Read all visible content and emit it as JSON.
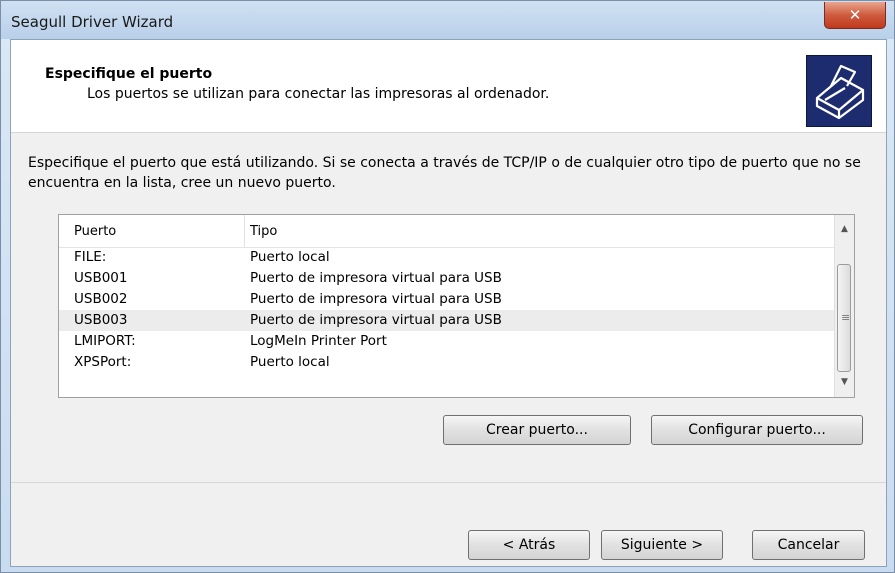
{
  "window": {
    "title": "Seagull Driver Wizard",
    "close_glyph": "✕"
  },
  "header": {
    "title": "Especifique el puerto",
    "subtitle": "Los puertos se utilizan para conectar las impresoras al ordenador.",
    "icon": "printer-icon"
  },
  "description": "Especifique el puerto que está utilizando. Si se conecta a través de TCP/IP o de cualquier otro tipo de puerto que no se encuentra en la lista, cree un nuevo puerto.",
  "port_list": {
    "columns": [
      "Puerto",
      "Tipo"
    ],
    "rows": [
      {
        "port": "FILE:",
        "type": "Puerto local",
        "selected": false
      },
      {
        "port": "USB001",
        "type": "Puerto de impresora virtual para USB",
        "selected": false
      },
      {
        "port": "USB002",
        "type": "Puerto de impresora virtual para USB",
        "selected": false
      },
      {
        "port": "USB003",
        "type": "Puerto de impresora virtual para USB",
        "selected": true
      },
      {
        "port": "LMIPORT:",
        "type": "LogMeIn Printer Port",
        "selected": false
      },
      {
        "port": "XPSPort:",
        "type": "Puerto local",
        "selected": false
      }
    ]
  },
  "buttons": {
    "create_port": "Crear puerto...",
    "configure_port": "Configurar puerto...",
    "back": "< Atrás",
    "next": "Siguiente >",
    "cancel": "Cancelar"
  },
  "colors": {
    "selected_row": "#ececec",
    "icon_background": "#1d2c6e",
    "close_button": "#c0391c"
  }
}
